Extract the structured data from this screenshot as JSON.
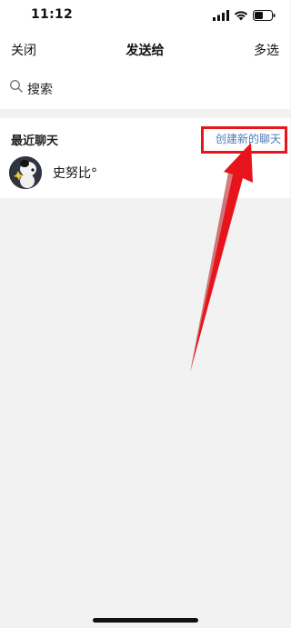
{
  "status_bar": {
    "time": "11:12"
  },
  "nav": {
    "close_label": "关闭",
    "title": "发送给",
    "multi_select_label": "多选"
  },
  "search": {
    "label": "搜索"
  },
  "recent": {
    "title": "最近聊天",
    "create_new_label": "创建新的聊天",
    "chats": [
      {
        "name": "史努比°"
      }
    ]
  },
  "annotation": {
    "color": "#e8141b"
  }
}
